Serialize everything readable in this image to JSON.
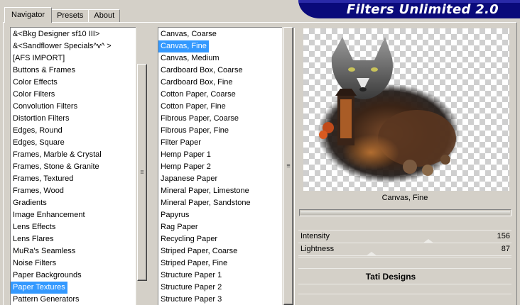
{
  "tabs": [
    {
      "label": "Navigator"
    },
    {
      "label": "Presets"
    },
    {
      "label": "About"
    }
  ],
  "banner": {
    "title": "Filters Unlimited 2.0"
  },
  "categories": {
    "items": [
      "&<Bkg Designer sf10 III>",
      "&<Sandflower Specials^v^ >",
      "[AFS IMPORT]",
      "Buttons & Frames",
      "Color Effects",
      "Color Filters",
      "Convolution Filters",
      "Distortion Filters",
      "Edges, Round",
      "Edges, Square",
      "Frames, Marble & Crystal",
      "Frames, Stone & Granite",
      "Frames, Textured",
      "Frames, Wood",
      "Gradients",
      "Image Enhancement",
      "Lens Effects",
      "Lens Flares",
      "MuRa's Seamless",
      "Noise Filters",
      "Paper Backgrounds",
      "Paper Textures",
      "Pattern Generators"
    ],
    "selected_index": 21
  },
  "filters": {
    "items": [
      "Canvas, Coarse",
      "Canvas, Fine",
      "Canvas, Medium",
      "Cardboard Box, Coarse",
      "Cardboard Box, Fine",
      "Cotton Paper, Coarse",
      "Cotton Paper, Fine",
      "Fibrous Paper, Coarse",
      "Fibrous Paper, Fine",
      "Filter Paper",
      "Hemp Paper 1",
      "Hemp Paper 2",
      "Japanese Paper",
      "Mineral Paper, Limestone",
      "Mineral Paper, Sandstone",
      "Papyrus",
      "Rag Paper",
      "Recycling Paper",
      "Striped Paper, Coarse",
      "Striped Paper, Fine",
      "Structure Paper 1",
      "Structure Paper 2",
      "Structure Paper 3"
    ],
    "selected_index": 1
  },
  "preview": {
    "filter_name": "Canvas, Fine"
  },
  "params": [
    {
      "label": "Intensity",
      "value": "156"
    },
    {
      "label": "Lightness",
      "value": "87"
    }
  ],
  "credit": "Tati Designs",
  "colors": {
    "selection": "#3399ff",
    "banner": "#0a0a7a",
    "face": "#d4d0c8"
  }
}
